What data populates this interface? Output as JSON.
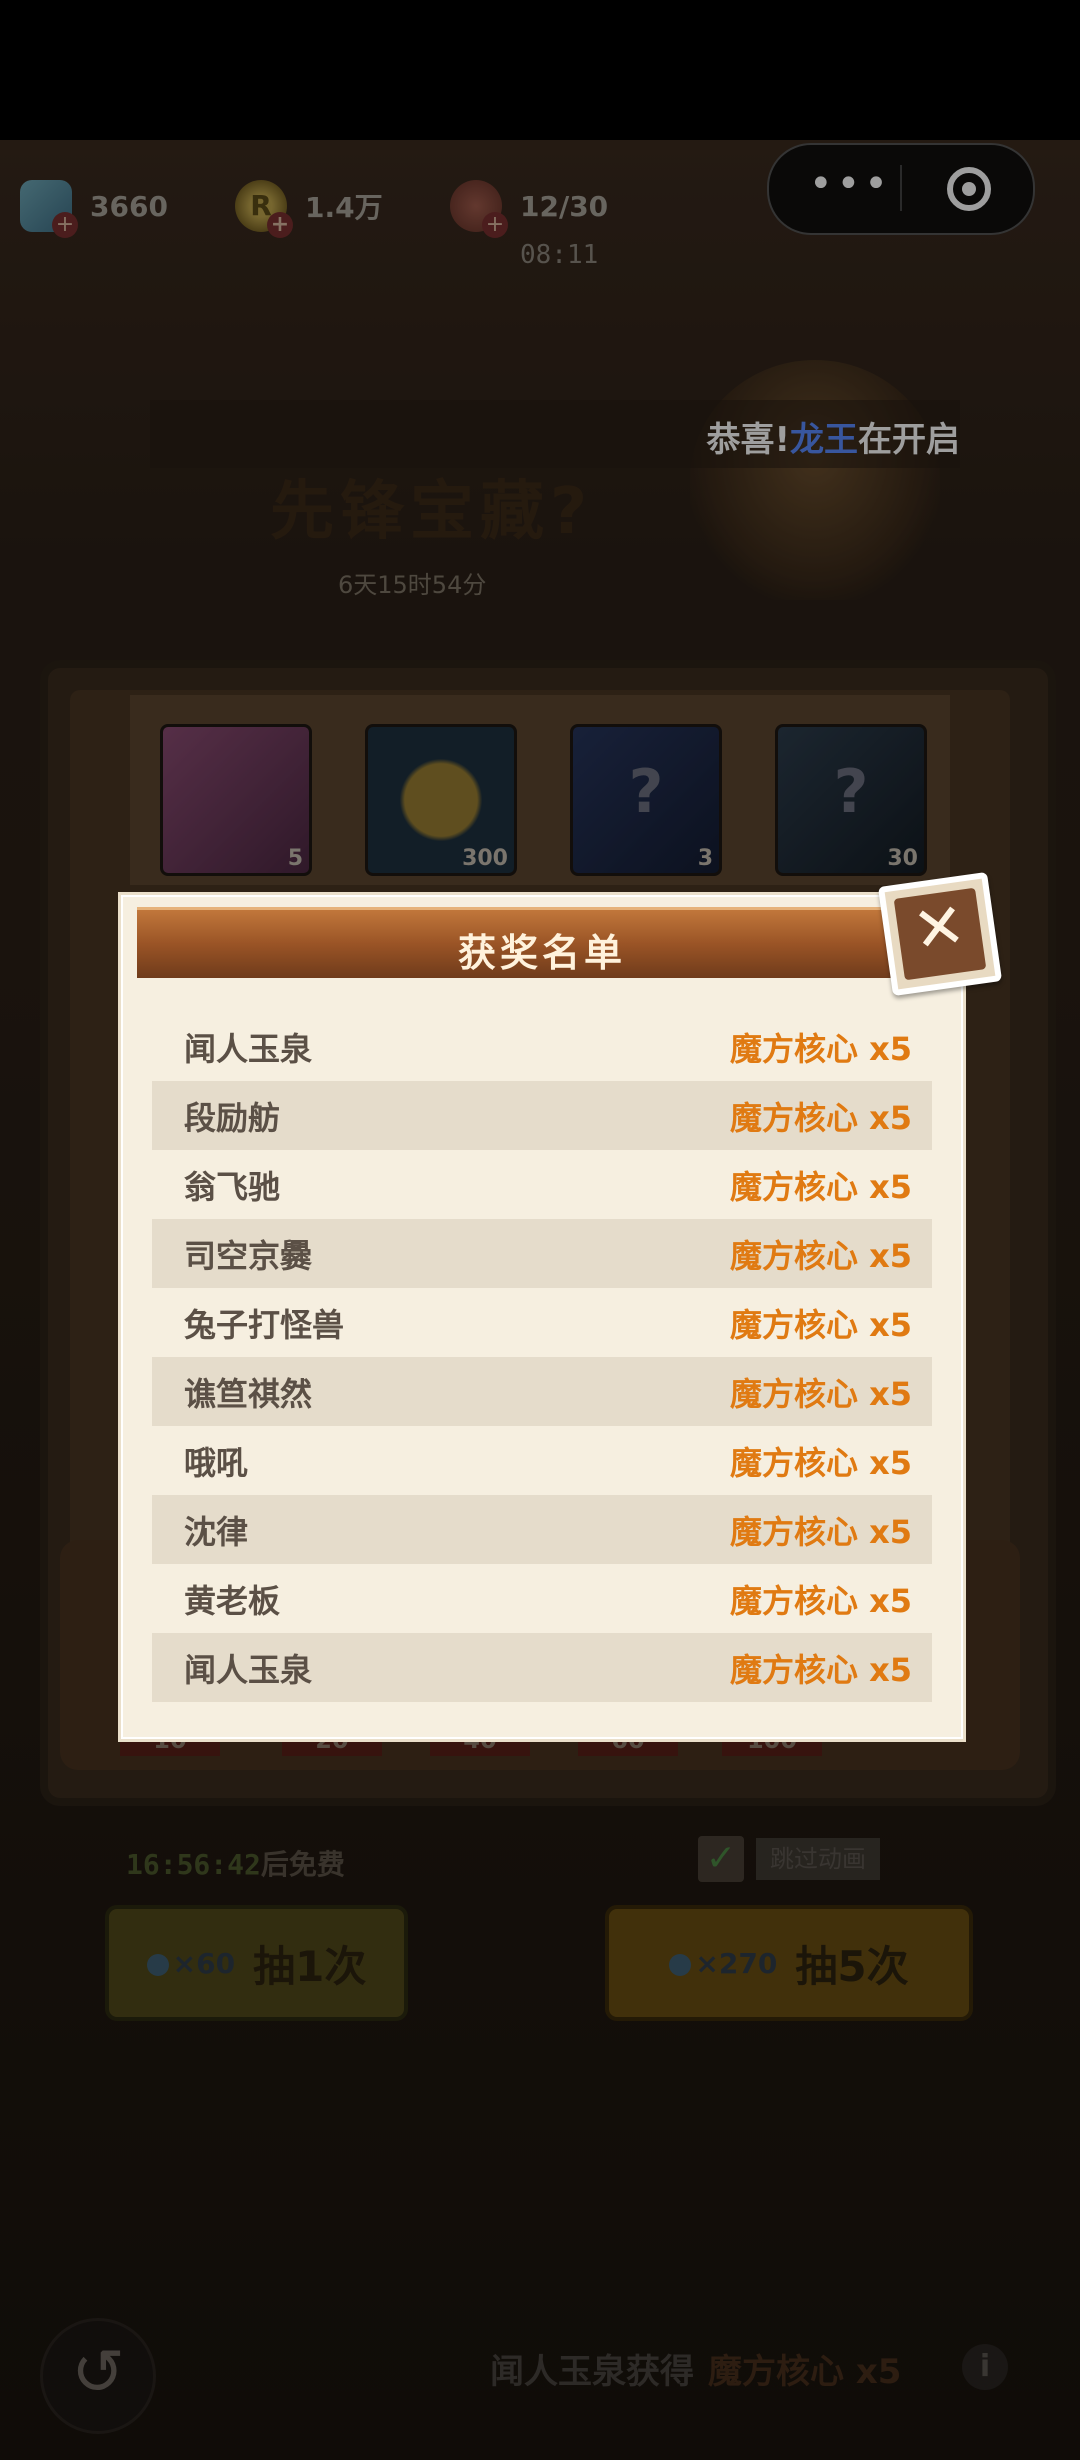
{
  "resources": {
    "gems": "3660",
    "coins": "1.4万",
    "coin_symbol": "R",
    "stamina": "12/30",
    "stamina_timer": "08:11",
    "plus": "+"
  },
  "capsule": {
    "more": "•••"
  },
  "marquee": {
    "prefix": "恭喜!",
    "name": "龙王",
    "suffix": "在开启"
  },
  "banner": {
    "title": "先锋宝藏?",
    "time_left": "6天15时54分"
  },
  "prizes": [
    {
      "icon": "cube-icon",
      "count": "5"
    },
    {
      "icon": "coin-icon",
      "count": "300"
    },
    {
      "icon": "mystery-box-icon",
      "count": "3",
      "symbol": "?"
    },
    {
      "icon": "mystery-card-icon",
      "count": "30",
      "symbol": "?"
    }
  ],
  "progress_marks": [
    "10",
    "20",
    "40",
    "60",
    "100"
  ],
  "free": {
    "time": "16:56:42",
    "suffix": "后免费"
  },
  "skip": {
    "check": "✓",
    "label": "跳过动画"
  },
  "draw_one": {
    "cost": "×60",
    "label": "抽1次"
  },
  "draw_five": {
    "cost": "×270",
    "label": "抽5次"
  },
  "dialog": {
    "title": "获奖名单",
    "close": "✕",
    "winners": [
      {
        "name": "闻人玉泉",
        "prize": "魔方核心 x5"
      },
      {
        "name": "段励舫",
        "prize": "魔方核心 x5"
      },
      {
        "name": "翁飞驰",
        "prize": "魔方核心 x5"
      },
      {
        "name": "司空京爨",
        "prize": "魔方核心 x5"
      },
      {
        "name": "兔子打怪兽",
        "prize": "魔方核心 x5"
      },
      {
        "name": "谯笪祺然",
        "prize": "魔方核心 x5"
      },
      {
        "name": "哦吼",
        "prize": "魔方核心 x5"
      },
      {
        "name": "沈律",
        "prize": "魔方核心 x5"
      },
      {
        "name": "黄老板",
        "prize": "魔方核心 x5"
      },
      {
        "name": "闻人玉泉",
        "prize": "魔方核心 x5"
      }
    ]
  },
  "bottom": {
    "back": "↺",
    "note_name": "闻人玉泉获得",
    "note_prize": "魔方核心 x5",
    "info": "i"
  }
}
